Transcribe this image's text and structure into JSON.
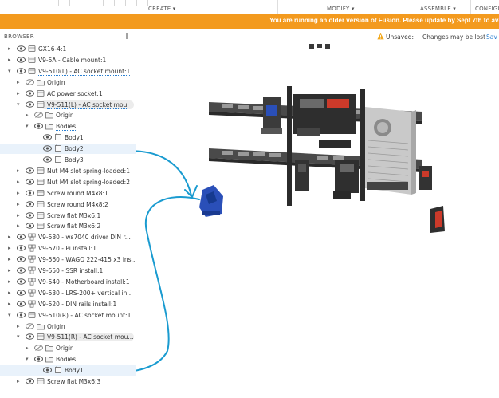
{
  "toolbar": {
    "create_label": "CREATE ▾",
    "modify_label": "MODIFY ▾",
    "assemble_label": "ASSEMBLE ▾",
    "configure_label": "CONFIGU"
  },
  "banner": {
    "text": "You are running an older version of Fusion. Please update by Sept 7th to avo"
  },
  "browser": {
    "title": "BROWSER",
    "close_glyph": "‖"
  },
  "status": {
    "unsaved_label": "Unsaved:",
    "changes_text": "Changes may be lost",
    "save_label": "Sav"
  },
  "tree": [
    {
      "label": "GX16-4:1",
      "indent": 0,
      "arrow": "▸",
      "eye": "open",
      "icon": "component"
    },
    {
      "label": "V9-5A - Cable mount:1",
      "indent": 0,
      "arrow": "▸",
      "eye": "open",
      "icon": "component"
    },
    {
      "label": "V9-510(L) - AC socket mount:1",
      "indent": 0,
      "arrow": "▾",
      "eye": "open",
      "icon": "component",
      "dotted": true
    },
    {
      "label": "Origin",
      "indent": 1,
      "arrow": "▸",
      "eye": "hidden",
      "icon": "folder"
    },
    {
      "label": "AC power socket:1",
      "indent": 1,
      "arrow": "▸",
      "eye": "open",
      "icon": "component"
    },
    {
      "label": "V9-511(L) - AC socket mou",
      "indent": 1,
      "arrow": "▾",
      "eye": "open",
      "icon": "component",
      "dotted": true,
      "pill": true
    },
    {
      "label": "Origin",
      "indent": 2,
      "arrow": "▸",
      "eye": "hidden",
      "icon": "folder"
    },
    {
      "label": "Bodies",
      "indent": 2,
      "arrow": "▾",
      "eye": "open",
      "icon": "folder",
      "dotted": true
    },
    {
      "label": "Body1",
      "indent": 3,
      "arrow": "",
      "eye": "open",
      "icon": "body"
    },
    {
      "label": "Body2",
      "indent": 3,
      "arrow": "",
      "eye": "open",
      "icon": "body",
      "highlight": true
    },
    {
      "label": "Body3",
      "indent": 3,
      "arrow": "",
      "eye": "open",
      "icon": "body"
    },
    {
      "label": "Nut M4 slot spring-loaded:1",
      "indent": 1,
      "arrow": "▸",
      "eye": "open",
      "icon": "component"
    },
    {
      "label": "Nut M4 slot spring-loaded:2",
      "indent": 1,
      "arrow": "▸",
      "eye": "open",
      "icon": "component"
    },
    {
      "label": "Screw round M4x8:1",
      "indent": 1,
      "arrow": "▸",
      "eye": "open",
      "icon": "component"
    },
    {
      "label": "Screw round M4x8:2",
      "indent": 1,
      "arrow": "▸",
      "eye": "open",
      "icon": "component"
    },
    {
      "label": "Screw flat M3x6:1",
      "indent": 1,
      "arrow": "▸",
      "eye": "open",
      "icon": "component"
    },
    {
      "label": "Screw flat M3x6:2",
      "indent": 1,
      "arrow": "▸",
      "eye": "open",
      "icon": "component"
    },
    {
      "label": "V9-580 - ws7040 driver DIN r...",
      "indent": 0,
      "arrow": "▸",
      "eye": "open",
      "icon": "assembly"
    },
    {
      "label": "V9-570 - Pi install:1",
      "indent": 0,
      "arrow": "▸",
      "eye": "open",
      "icon": "assembly"
    },
    {
      "label": "V9-560 - WAGO 222-415 x3 ins...",
      "indent": 0,
      "arrow": "▸",
      "eye": "open",
      "icon": "assembly"
    },
    {
      "label": "V9-550 - SSR install:1",
      "indent": 0,
      "arrow": "▸",
      "eye": "open",
      "icon": "assembly"
    },
    {
      "label": "V9-540 - Motherboard install:1",
      "indent": 0,
      "arrow": "▸",
      "eye": "open",
      "icon": "assembly"
    },
    {
      "label": "V9-530 - LRS-200+ vertical in...",
      "indent": 0,
      "arrow": "▸",
      "eye": "open",
      "icon": "assembly"
    },
    {
      "label": "V9-520 - DIN rails install:1",
      "indent": 0,
      "arrow": "▸",
      "eye": "open",
      "icon": "assembly"
    },
    {
      "label": "V9-510(R) - AC socket mount:1",
      "indent": 0,
      "arrow": "▾",
      "eye": "open",
      "icon": "component"
    },
    {
      "label": "Origin",
      "indent": 1,
      "arrow": "▸",
      "eye": "hidden",
      "icon": "folder"
    },
    {
      "label": "V9-511(R) - AC socket mou...",
      "indent": 1,
      "arrow": "▾",
      "eye": "open",
      "icon": "component",
      "pill": true
    },
    {
      "label": "Origin",
      "indent": 2,
      "arrow": "▸",
      "eye": "hidden",
      "icon": "folder"
    },
    {
      "label": "Bodies",
      "indent": 2,
      "arrow": "▾",
      "eye": "open",
      "icon": "folder"
    },
    {
      "label": "Body1",
      "indent": 3,
      "arrow": "",
      "eye": "open",
      "icon": "body",
      "highlight": true
    },
    {
      "label": "Screw flat M3x6:3",
      "indent": 1,
      "arrow": "▸",
      "eye": "open",
      "icon": "component"
    }
  ],
  "colors": {
    "banner": "#f39a1e",
    "annotation": "#1a9bd0",
    "part_blue": "#2a4fb8",
    "rail": "#3a3a3a"
  },
  "icons": {
    "warning": "warning-icon",
    "eye": "eye-icon",
    "eye_hidden": "eye-hidden-icon",
    "folder": "folder-icon",
    "component": "component-icon",
    "body": "body-icon"
  }
}
